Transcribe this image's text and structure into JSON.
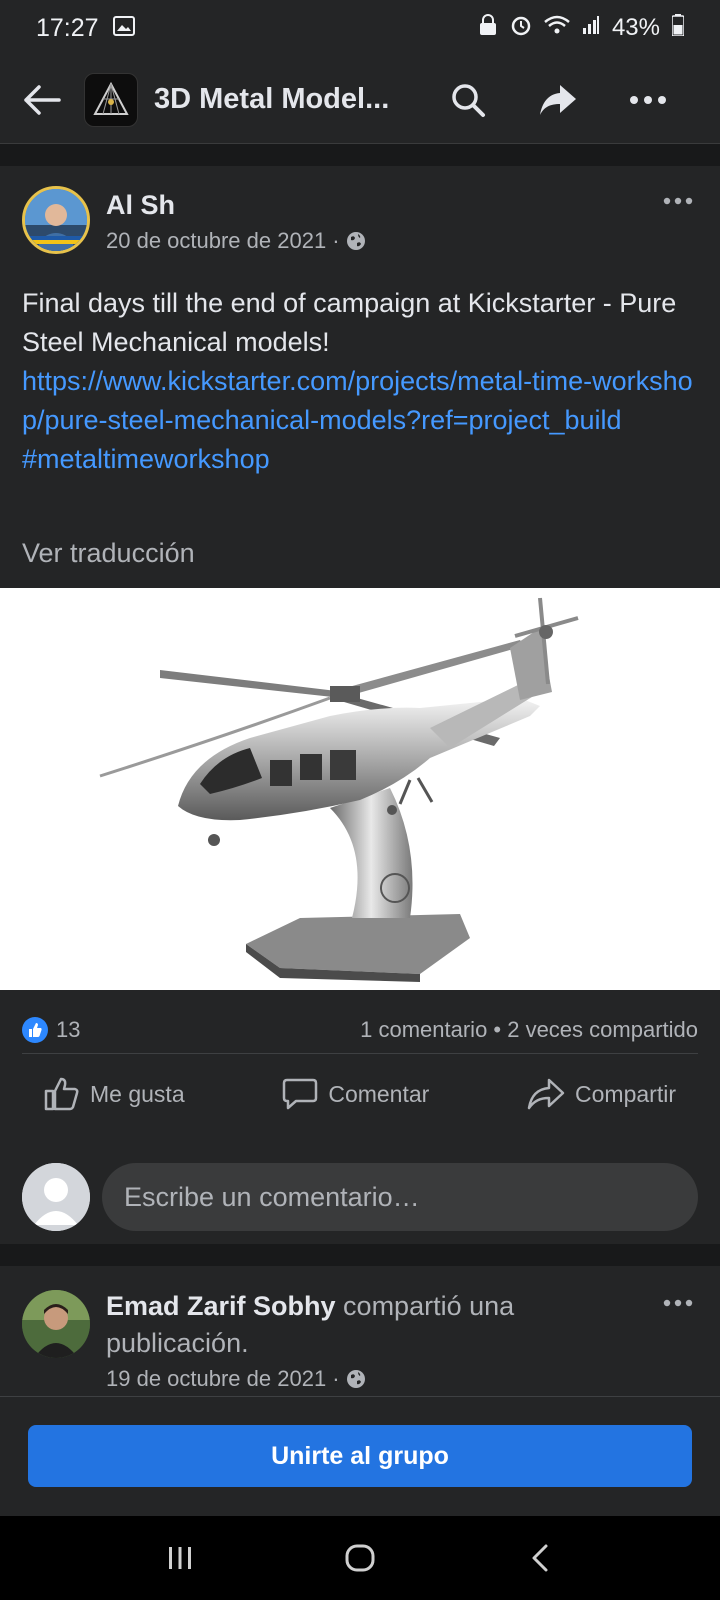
{
  "status_bar": {
    "time": "17:27",
    "battery": "43%"
  },
  "app_bar": {
    "group_title": "3D Metal Model..."
  },
  "post": {
    "author": "Al Sh",
    "date": "20 de octubre de 2021 ·",
    "text_line": "Final days till the end of campaign at Kickstarter - Pure Steel Mechanical models!",
    "link": "https://www.kickstarter.com/projects/metal-time-workshop/pure-steel-mechanical-models?ref=project_build",
    "hashtag": "#metaltimeworkshop",
    "translate_label": "Ver traducción",
    "likes_count": "13",
    "comments_shares": "1 comentario • 2 veces compartido",
    "actions": {
      "like": "Me gusta",
      "comment": "Comentar",
      "share": "Compartir"
    },
    "comment_placeholder": "Escribe un comentario…"
  },
  "post2": {
    "author": "Emad Zarif Sobhy",
    "action_text": " compartió una publicación.",
    "date": "19 de octubre de 2021 ·"
  },
  "join_button": "Unirte al grupo",
  "colors": {
    "accent": "#2374e1",
    "link": "#4599ff",
    "card_bg": "#242526",
    "page_bg": "#18191a"
  }
}
